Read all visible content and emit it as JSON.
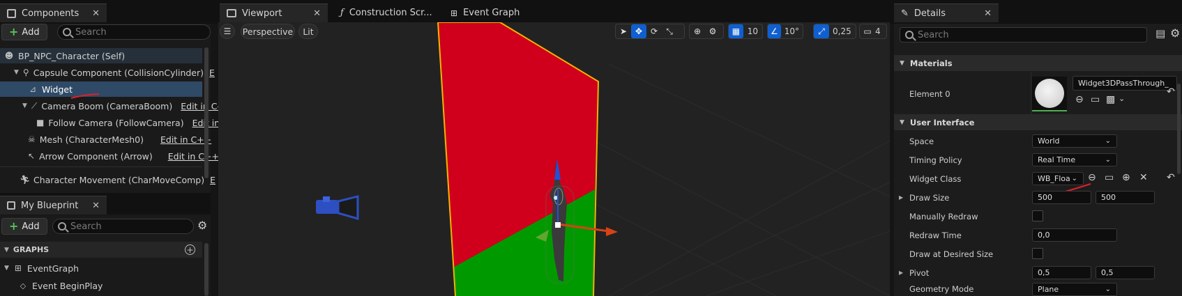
{
  "components_panel": {
    "tab_label": "Components",
    "add_label": "Add",
    "search_placeholder": "Search",
    "tree": [
      {
        "label": "BP_NPC_Character (Self)",
        "edit": ""
      },
      {
        "label": "Capsule Component (CollisionCylinder)",
        "edit": "E"
      },
      {
        "label": "Widget",
        "edit": ""
      },
      {
        "label": "Camera Boom (CameraBoom)",
        "edit": "Edit in C-"
      },
      {
        "label": "Follow Camera (FollowCamera)",
        "edit": "Edit in"
      },
      {
        "label": "Mesh (CharacterMesh0)",
        "edit": "Edit in C++"
      },
      {
        "label": "Arrow Component (Arrow)",
        "edit": "Edit in C++"
      },
      {
        "label": "Character Movement (CharMoveComp)",
        "edit": "E"
      }
    ]
  },
  "blueprint_panel": {
    "tab_label": "My Blueprint",
    "add_label": "Add",
    "search_placeholder": "Search",
    "graphs_label": "GRAPHS",
    "event_graph": "EventGraph",
    "begin_play": "Event BeginPlay"
  },
  "editor_tabs": {
    "viewport": "Viewport",
    "construction": "Construction Scr...",
    "event_graph": "Event Graph"
  },
  "viewport": {
    "perspective": "Perspective",
    "lit": "Lit",
    "grid_size": "10",
    "rotation_snap": "10°",
    "scale_snap": "0,25",
    "camera_speed": "4"
  },
  "details": {
    "tab_label": "Details",
    "search_placeholder": "Search",
    "materials_header": "Materials",
    "element0_label": "Element 0",
    "material_name": "Widget3DPassThrough_",
    "ui_header": "User Interface",
    "rows": {
      "space_label": "Space",
      "space_value": "World",
      "timing_label": "Timing Policy",
      "timing_value": "Real Time",
      "widget_class_label": "Widget Class",
      "widget_class_value": "WB_Floa",
      "draw_size_label": "Draw Size",
      "draw_size_x": "500",
      "draw_size_y": "500",
      "manual_redraw_label": "Manually Redraw",
      "redraw_time_label": "Redraw Time",
      "redraw_time_value": "0,0",
      "draw_desired_label": "Draw at Desired Size",
      "pivot_label": "Pivot",
      "pivot_x": "0,5",
      "pivot_y": "0,5",
      "geometry_label": "Geometry Mode",
      "geometry_value": "Plane"
    }
  },
  "colors": {
    "accent_blue": "#0f5fd0",
    "widget_red": "#d0001c",
    "widget_green": "#009a00",
    "selection": "#2f4a66"
  }
}
